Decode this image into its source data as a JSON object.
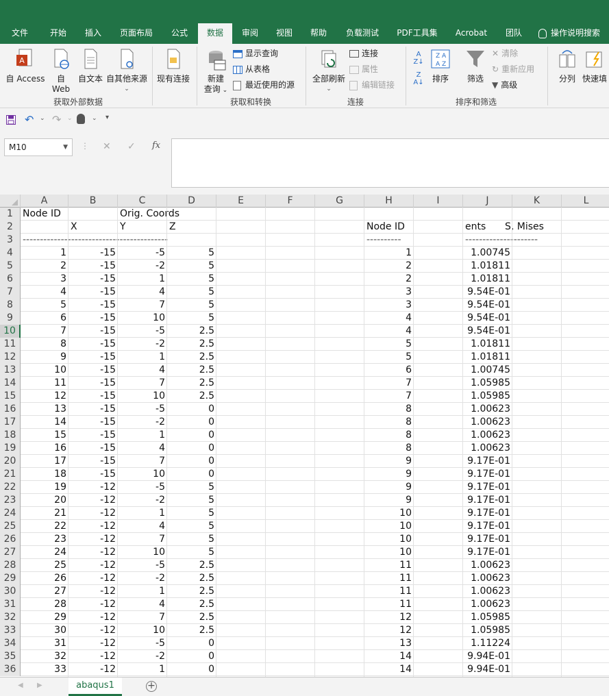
{
  "tabs": [
    "文件",
    "开始",
    "插入",
    "页面布局",
    "公式",
    "数据",
    "审阅",
    "视图",
    "帮助",
    "负载测试",
    "PDF工具集",
    "Acrobat",
    "团队",
    "操作说明搜索"
  ],
  "active_tab": "数据",
  "ribbon": {
    "get_external": {
      "access_label": "自 Access",
      "web_label_1": "自",
      "web_label_2": "Web",
      "text_label": "自文本",
      "other_label": "自其他来源",
      "group_label": "获取外部数据"
    },
    "existing_label": "现有连接",
    "transform": {
      "new_query_1": "新建",
      "new_query_2": "查询",
      "show_query": "显示查询",
      "from_table": "从表格",
      "recent_sources": "最近使用的源",
      "group_label": "获取和转换"
    },
    "connections": {
      "refresh_all": "全部刷新",
      "connections": "连接",
      "properties": "属性",
      "edit_links": "编辑链接",
      "group_label": "连接"
    },
    "sort_filter": {
      "sort": "排序",
      "filter": "筛选",
      "clear": "清除",
      "reapply": "重新应用",
      "advanced": "高级",
      "group_label": "排序和筛选"
    },
    "data_tools": {
      "split": "分列",
      "flash": "快速填"
    }
  },
  "namebox": "M10",
  "fx_label": "fx",
  "columns": [
    "A",
    "B",
    "C",
    "D",
    "E",
    "F",
    "G",
    "H",
    "I",
    "J",
    "K",
    "L"
  ],
  "selected_row": "10",
  "header_rows": [
    {
      "num": "1",
      "a": "Node ID",
      "c": "Orig. Coords",
      "h": "",
      "j": ""
    },
    {
      "num": "2",
      "a": "",
      "b": "X",
      "c": "Y",
      "d": "Z",
      "h": "Node ID",
      "j": "ents",
      "k": "S, Mises"
    },
    {
      "num": "3",
      "dashes_left": "------------------------------------------",
      "dashes_h": "----------",
      "dashes_j": "---------------------"
    }
  ],
  "rows": [
    {
      "num": "4",
      "a": "1",
      "b": "-15",
      "c": "-5",
      "d": "5",
      "h": "1",
      "j": "1.00745"
    },
    {
      "num": "5",
      "a": "2",
      "b": "-15",
      "c": "-2",
      "d": "5",
      "h": "2",
      "j": "1.01811"
    },
    {
      "num": "6",
      "a": "3",
      "b": "-15",
      "c": "1",
      "d": "5",
      "h": "2",
      "j": "1.01811"
    },
    {
      "num": "7",
      "a": "4",
      "b": "-15",
      "c": "4",
      "d": "5",
      "h": "3",
      "j": "9.54E-01"
    },
    {
      "num": "8",
      "a": "5",
      "b": "-15",
      "c": "7",
      "d": "5",
      "h": "3",
      "j": "9.54E-01"
    },
    {
      "num": "9",
      "a": "6",
      "b": "-15",
      "c": "10",
      "d": "5",
      "h": "4",
      "j": "9.54E-01"
    },
    {
      "num": "10",
      "a": "7",
      "b": "-15",
      "c": "-5",
      "d": "2.5",
      "h": "4",
      "j": "9.54E-01"
    },
    {
      "num": "11",
      "a": "8",
      "b": "-15",
      "c": "-2",
      "d": "2.5",
      "h": "5",
      "j": "1.01811"
    },
    {
      "num": "12",
      "a": "9",
      "b": "-15",
      "c": "1",
      "d": "2.5",
      "h": "5",
      "j": "1.01811"
    },
    {
      "num": "13",
      "a": "10",
      "b": "-15",
      "c": "4",
      "d": "2.5",
      "h": "6",
      "j": "1.00745"
    },
    {
      "num": "14",
      "a": "11",
      "b": "-15",
      "c": "7",
      "d": "2.5",
      "h": "7",
      "j": "1.05985"
    },
    {
      "num": "15",
      "a": "12",
      "b": "-15",
      "c": "10",
      "d": "2.5",
      "h": "7",
      "j": "1.05985"
    },
    {
      "num": "16",
      "a": "13",
      "b": "-15",
      "c": "-5",
      "d": "0",
      "h": "8",
      "j": "1.00623"
    },
    {
      "num": "17",
      "a": "14",
      "b": "-15",
      "c": "-2",
      "d": "0",
      "h": "8",
      "j": "1.00623"
    },
    {
      "num": "18",
      "a": "15",
      "b": "-15",
      "c": "1",
      "d": "0",
      "h": "8",
      "j": "1.00623"
    },
    {
      "num": "19",
      "a": "16",
      "b": "-15",
      "c": "4",
      "d": "0",
      "h": "8",
      "j": "1.00623"
    },
    {
      "num": "20",
      "a": "17",
      "b": "-15",
      "c": "7",
      "d": "0",
      "h": "9",
      "j": "9.17E-01"
    },
    {
      "num": "21",
      "a": "18",
      "b": "-15",
      "c": "10",
      "d": "0",
      "h": "9",
      "j": "9.17E-01"
    },
    {
      "num": "22",
      "a": "19",
      "b": "-12",
      "c": "-5",
      "d": "5",
      "h": "9",
      "j": "9.17E-01"
    },
    {
      "num": "23",
      "a": "20",
      "b": "-12",
      "c": "-2",
      "d": "5",
      "h": "9",
      "j": "9.17E-01"
    },
    {
      "num": "24",
      "a": "21",
      "b": "-12",
      "c": "1",
      "d": "5",
      "h": "10",
      "j": "9.17E-01"
    },
    {
      "num": "25",
      "a": "22",
      "b": "-12",
      "c": "4",
      "d": "5",
      "h": "10",
      "j": "9.17E-01"
    },
    {
      "num": "26",
      "a": "23",
      "b": "-12",
      "c": "7",
      "d": "5",
      "h": "10",
      "j": "9.17E-01"
    },
    {
      "num": "27",
      "a": "24",
      "b": "-12",
      "c": "10",
      "d": "5",
      "h": "10",
      "j": "9.17E-01"
    },
    {
      "num": "28",
      "a": "25",
      "b": "-12",
      "c": "-5",
      "d": "2.5",
      "h": "11",
      "j": "1.00623"
    },
    {
      "num": "29",
      "a": "26",
      "b": "-12",
      "c": "-2",
      "d": "2.5",
      "h": "11",
      "j": "1.00623"
    },
    {
      "num": "30",
      "a": "27",
      "b": "-12",
      "c": "1",
      "d": "2.5",
      "h": "11",
      "j": "1.00623"
    },
    {
      "num": "31",
      "a": "28",
      "b": "-12",
      "c": "4",
      "d": "2.5",
      "h": "11",
      "j": "1.00623"
    },
    {
      "num": "32",
      "a": "29",
      "b": "-12",
      "c": "7",
      "d": "2.5",
      "h": "12",
      "j": "1.05985"
    },
    {
      "num": "33",
      "a": "30",
      "b": "-12",
      "c": "10",
      "d": "2.5",
      "h": "12",
      "j": "1.05985"
    },
    {
      "num": "34",
      "a": "31",
      "b": "-12",
      "c": "-5",
      "d": "0",
      "h": "13",
      "j": "1.11224"
    },
    {
      "num": "35",
      "a": "32",
      "b": "-12",
      "c": "-2",
      "d": "0",
      "h": "14",
      "j": "9.94E-01"
    },
    {
      "num": "36",
      "a": "33",
      "b": "-12",
      "c": "1",
      "d": "0",
      "h": "14",
      "j": "9.94E-01"
    }
  ],
  "sheet_tab": "abaqus1",
  "colors": {
    "accent": "#217346",
    "ribbon_bg": "#f3f3f3"
  }
}
